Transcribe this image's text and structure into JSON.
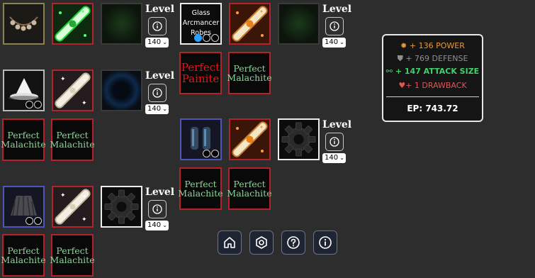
{
  "level_label": "Level",
  "level_value": "140",
  "gems": {
    "malachite": "Perfect Malachite",
    "painite": "Perfect Painite"
  },
  "items": {
    "glass_robes_name": "Glass Arcmancer Robes"
  },
  "stats": {
    "power": "+ 136 POWER",
    "defense": "+ 769 DEFENSE",
    "attack_size": "+ 147 ATTACK SIZE",
    "drawback": "+ 1 DRAWBACK",
    "ep": "EP: 743.72"
  },
  "colors": {
    "power": "#e59a3a",
    "defense": "#8f8f8f",
    "attack_size": "#3fd46a",
    "drawback": "#e35454"
  },
  "nav": [
    "home-icon",
    "settings-icon",
    "help-icon",
    "info-icon"
  ]
}
